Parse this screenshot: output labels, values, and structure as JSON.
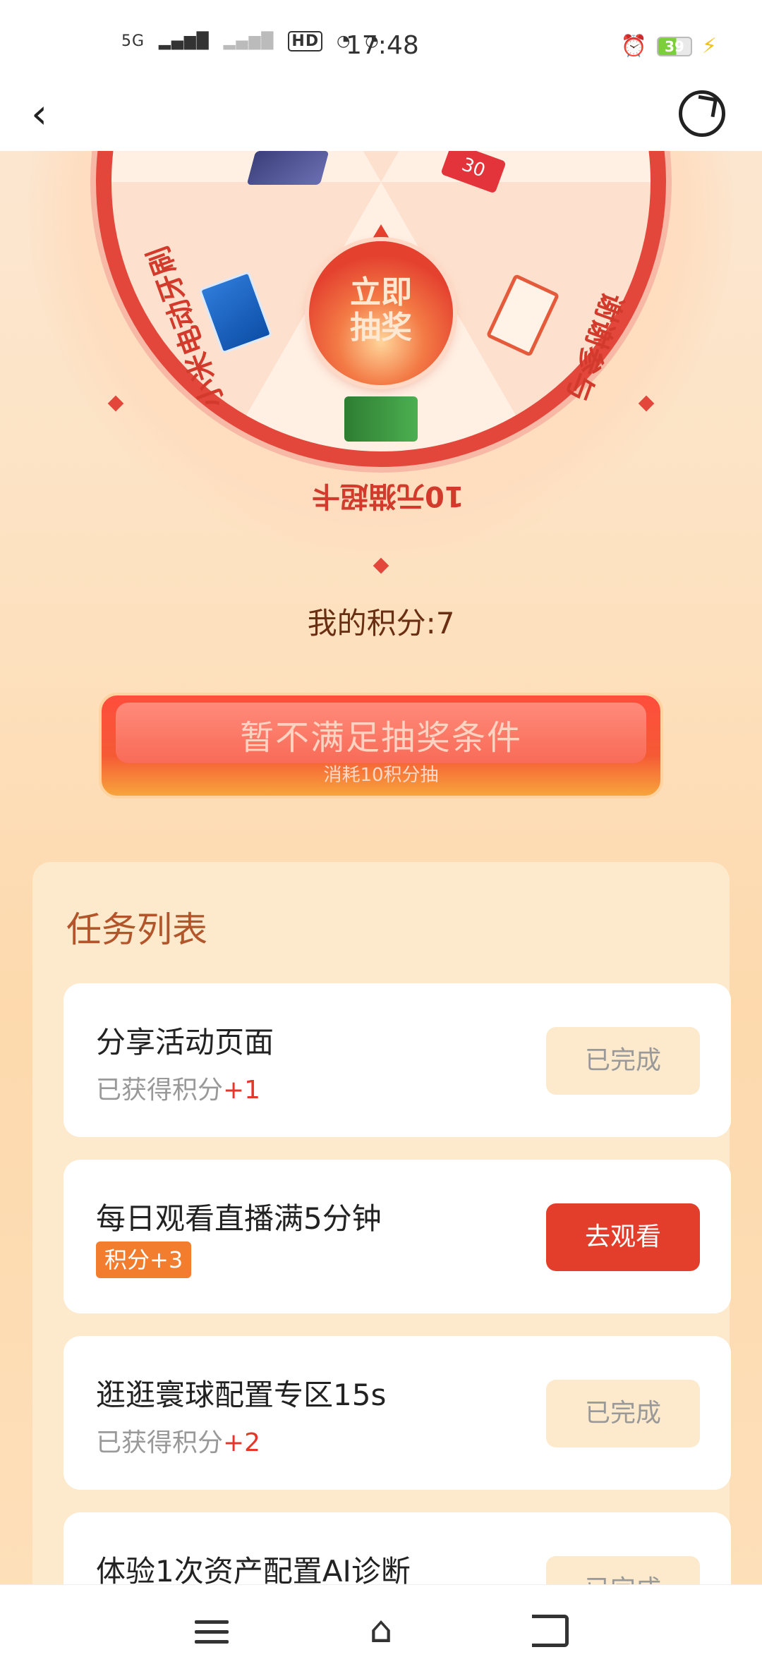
{
  "status_bar": {
    "network": "5G",
    "hd": "HD",
    "time": "17:48",
    "battery": "39"
  },
  "nav": {
    "back_icon": "chevron-left-icon",
    "share_icon": "share-refresh-icon"
  },
  "wheel": {
    "center_label_line1": "立即",
    "center_label_line2": "抽奖",
    "prizes": [
      "小米电动牙刷",
      "10元猫超卡",
      "谢谢参与"
    ]
  },
  "score": {
    "label": "我的积分:7"
  },
  "lottery_button": {
    "title": "暂不满足抽奖条件",
    "subtitle": "消耗10积分抽"
  },
  "tasks": {
    "title": "任务列表",
    "items": [
      {
        "name": "分享活动页面",
        "sub_prefix": "已获得积分",
        "points": "+1",
        "button": "已完成"
      },
      {
        "name": "每日观看直播满5分钟",
        "badge": "积分+3",
        "button": "去观看"
      },
      {
        "name": "逛逛寰球配置专区15s",
        "sub_prefix": "已获得积分",
        "points": "+2",
        "button": "已完成"
      },
      {
        "name": "体验1次资产配置AI诊断",
        "button": "已完成"
      }
    ]
  },
  "colors": {
    "accent_red": "#e23e2b",
    "orange_badge": "#f27d2e",
    "title_brown": "#b2552a"
  }
}
